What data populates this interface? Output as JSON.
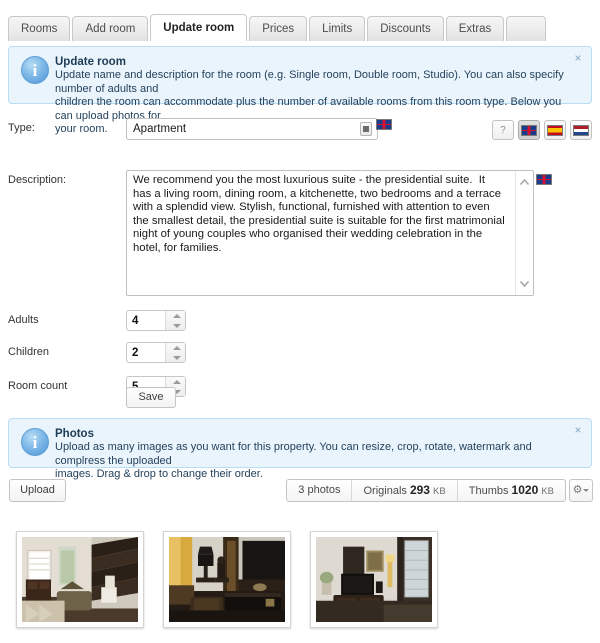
{
  "tabs": [
    {
      "label": "Rooms",
      "active": false
    },
    {
      "label": "Add room",
      "active": false
    },
    {
      "label": "Update room",
      "active": true
    },
    {
      "label": "Prices",
      "active": false
    },
    {
      "label": "Limits",
      "active": false
    },
    {
      "label": "Discounts",
      "active": false
    },
    {
      "label": "Extras",
      "active": false
    }
  ],
  "info_update": {
    "icon": "info-icon",
    "title": "Update room",
    "body_line1": "Update name and description for the room (e.g. Single room, Double room, Studio). You can also specify number of adults and",
    "body_line2": "children the room can accommodate plus the number of available rooms from this room type. Below you can upload photos for",
    "body_line3": "your room.",
    "close_label": "×"
  },
  "form": {
    "type_label": "Type:",
    "type_value": "Apartment",
    "type_flag": "flag-uk-icon",
    "description_label": "Description:",
    "description_value": "We recommend you the most luxurious suite - the presidential suite.  It has a living room, dining room, a kitchenette, two bedrooms and a terrace with a splendid view. Stylish, functional, furnished with attention to even the smallest detail, the presidential suite is suitable for the first matrimonial night of young couples who organised their wedding celebration in the hotel, for families.",
    "description_flag": "flag-uk-icon",
    "adults_label": "Adults",
    "adults_value": "4",
    "children_label": "Children",
    "children_value": "2",
    "room_count_label": "Room count",
    "room_count_value": "5",
    "save_label": "Save"
  },
  "languages": [
    {
      "name": "help-button",
      "glyph": "?",
      "selected": false
    },
    {
      "name": "flag-uk-button",
      "glyph": "",
      "selected": true
    },
    {
      "name": "flag-es-button",
      "glyph": "",
      "selected": false
    },
    {
      "name": "flag-nl-button",
      "glyph": "",
      "selected": false
    }
  ],
  "info_photos": {
    "icon": "info-icon",
    "title": "Photos",
    "body_line1": "Upload as many images as you want for this property. You can resize, crop, rotate, watermark and complress the uploaded",
    "body_line2": "images. Drag & drop to change their order.",
    "close_label": "×"
  },
  "photos_toolbar": {
    "upload_label": "Upload",
    "count_label": "3 photos",
    "originals_label": "Originals",
    "originals_value": "293",
    "originals_unit": "KB",
    "thumbs_label": "Thumbs",
    "thumbs_value": "1020",
    "thumbs_unit": "KB",
    "gear_icon": "gear-icon",
    "caret_icon": "chevron-down-icon"
  },
  "thumbnails": [
    {
      "alt": "living room with staircase and sofa"
    },
    {
      "alt": "dark living room with television and coffee table"
    },
    {
      "alt": "room with flat screen television and window"
    }
  ],
  "colors": {
    "info_bg": "#eaf4fd",
    "info_border": "#b8ddf4",
    "tab_active_bg": "#ffffff",
    "page_bg": "#ffffff"
  }
}
